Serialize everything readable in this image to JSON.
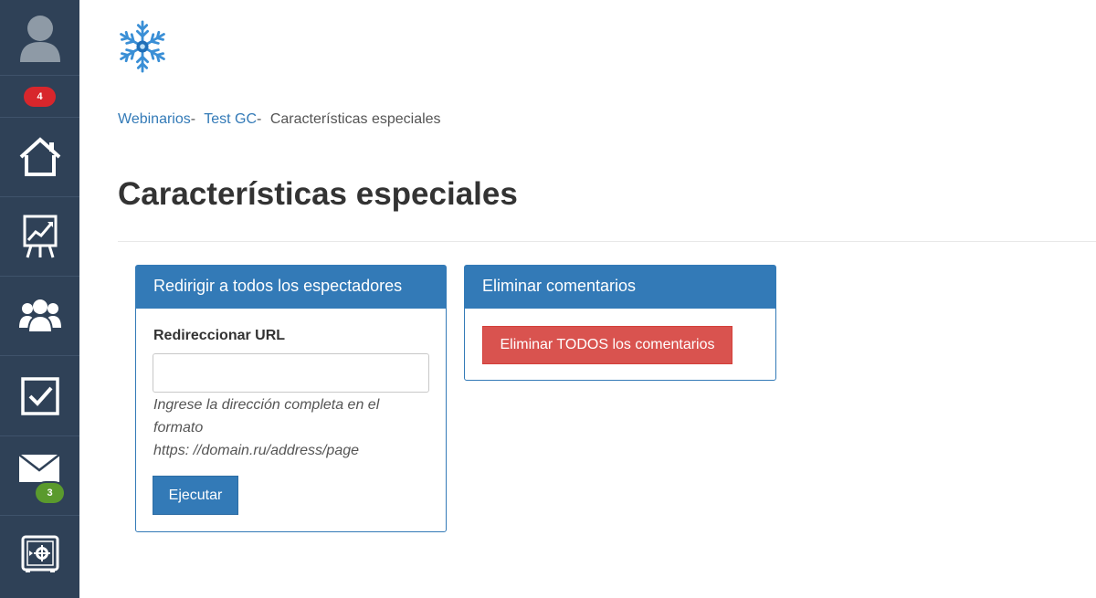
{
  "sidebar": {
    "notifications_count": "4",
    "mail_count": "3",
    "icons": [
      "user-avatar-icon",
      "home-icon",
      "chart-board-icon",
      "users-group-icon",
      "checkbox-icon",
      "mail-icon",
      "safe-icon"
    ]
  },
  "breadcrumb": {
    "item1": "Webinarios",
    "sep1": "-",
    "item2": "Test GC",
    "sep2": "-",
    "current": "Características especiales"
  },
  "page": {
    "title": "Características especiales"
  },
  "redirect_panel": {
    "title": "Redirigir a todos los espectadores",
    "field_label": "Redireccionar URL",
    "input_value": "",
    "help_line1": "Ingrese la dirección completa en el formato",
    "help_line2": "https: //domain.ru/address/page",
    "button": "Ejecutar"
  },
  "delete_panel": {
    "title": "Eliminar comentarios",
    "button": "Eliminar TODOS los comentarios"
  },
  "colors": {
    "sidebar": "#2f4157",
    "primary": "#337ab7",
    "danger": "#d9534f",
    "badge_red": "#d8262c",
    "badge_green": "#5a9a2d"
  }
}
